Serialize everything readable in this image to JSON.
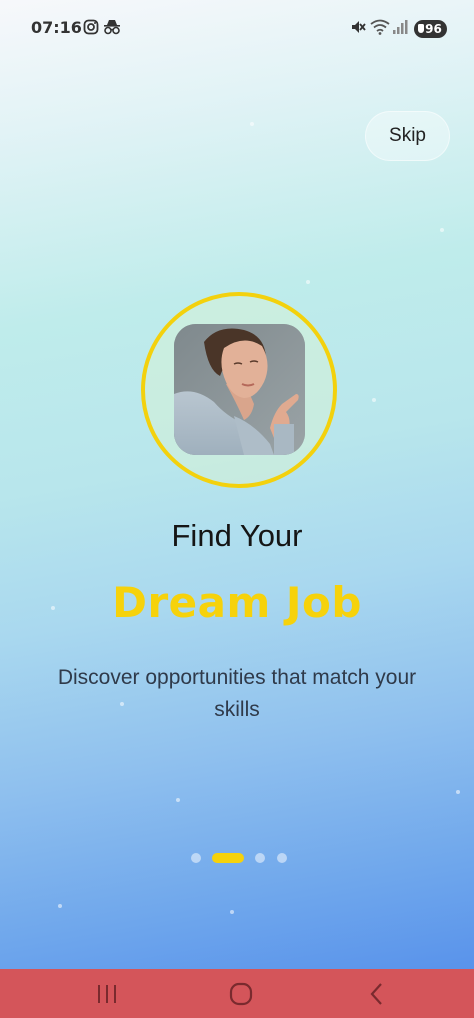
{
  "status_bar": {
    "time": "07:16",
    "left_icons": [
      "instagram-icon",
      "incognito-icon"
    ],
    "right_icons": [
      "mute-icon",
      "wifi-icon",
      "signal-icon"
    ],
    "battery": "96"
  },
  "skip_label": "Skip",
  "title_line1": "Find Your",
  "title_line2": "Dream Job",
  "subtitle": "Discover opportunities that match your skills",
  "page_indicator": {
    "count": 4,
    "active_index": 1
  },
  "nav_bar": {
    "icons": [
      "recent-apps-icon",
      "home-icon",
      "back-icon"
    ]
  },
  "colors": {
    "accent": "#f6d20b",
    "nav_bar": "#d4555a",
    "title": "#151515",
    "subtitle": "#2f3a4a"
  }
}
